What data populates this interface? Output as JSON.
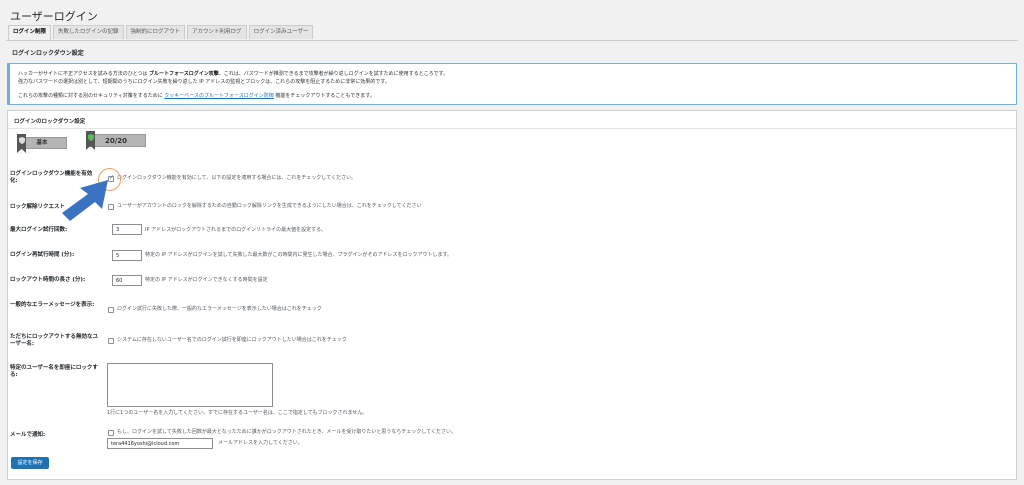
{
  "page": {
    "title": "ユーザーログイン"
  },
  "tabs": [
    {
      "label": "ログイン制限",
      "active": true
    },
    {
      "label": "失敗したログインの記録"
    },
    {
      "label": "強制的にログアウト"
    },
    {
      "label": "アカウント利用ログ"
    },
    {
      "label": "ログイン済みユーザー"
    }
  ],
  "section": {
    "title": "ログインロックダウン設定"
  },
  "notice": {
    "line1_a": "ハッカーがサイトに不正アクセスを試みる方法のひとつは ",
    "line1_b": "ブルートフォースログイン攻撃",
    "line1_c": "。これは、パスワードが推測できるまで攻撃者が繰り返しログインを試すために使用するところです。",
    "line2": "強力なパスワードの選択は別として、短期間のうちにログイン失敗を繰り返した IP アドレスの監視とブロックは、これらの攻撃を阻止するために非常に効果的です。",
    "line3_a": "これらの攻撃の種類に対する別のセキュリティ対策をするために ",
    "line3_link": "クッキーベースのブルートフォースログイン防御",
    "line3_b": " 機能をチェックアウトすることもできます。"
  },
  "panel": {
    "title": "ログインのロックダウン設定"
  },
  "badges": {
    "basic": "基本",
    "score": "20/20"
  },
  "rows": {
    "lockdown": {
      "label": "ログインロックダウン機能を有効化:",
      "desc": "ログインロックダウン機能を有効にして、以下の設定を適用する場合には、これをチェックしてください。",
      "checked": true
    },
    "unlock": {
      "label": "ロック解除リクエスト",
      "desc": "ユーザーがアカウントのロックを解除するための自動ロック解除リンクを生成できるようにしたい場合は、これをチェックしてください"
    },
    "max_attempts": {
      "label": "最大ログイン試行回数:",
      "value": "3",
      "desc": "IP アドレスがロックアウトされるまでのログインリトライの最大値を設定する。"
    },
    "retry_period": {
      "label": "ログイン再試行時間 (分):",
      "value": "5",
      "desc": "特定の IP アドレスがログインを試して失敗した最大数がこの時間内に発生した場合、プラグインがそのアドレスをロックアウトします。"
    },
    "lockout_length": {
      "label": "ロックアウト時間の長さ (分):",
      "value": "60",
      "desc": "特定の IP アドレスがログインできなくする時間を設定"
    },
    "generic_error": {
      "label": "一般的なエラーメッセージを表示:",
      "desc": "ログイン試行に失敗した際、一般的なエラーメッセージを表示したい場合はこれをチェック"
    },
    "invalid_user": {
      "label": "ただちにロックアウトする無効なユーザー名:",
      "desc": "システムに存在しないユーザー名でのログイン試行を即座にロックアウトしたい場合はこれをチェック"
    },
    "instant_lock": {
      "label": "特定のユーザー名を即座にロックする:",
      "desc": "1行に1つのユーザー名を入力してください。すでに存在するユーザー名は、ここで指定してもブロックされません。"
    },
    "email_notify": {
      "label": "メールで通知:",
      "desc": "もし、ログインを試して失敗した回数が最大となったために誰かがロックアウトされたとき、メールを受け取りたいと思うならチェックしてください。",
      "email": "tera4416yoshi@icloud.com",
      "email_desc": "メールアドレスを入力してください。"
    }
  },
  "save": {
    "label": "設定を保存"
  },
  "colors": {
    "accent": "#2271b1",
    "arrow": "#3a73c2",
    "highlight": "#f0a060"
  },
  "icons": {
    "arrow": "arrow-icon",
    "shield": "shield-icon",
    "check": "check-icon"
  }
}
